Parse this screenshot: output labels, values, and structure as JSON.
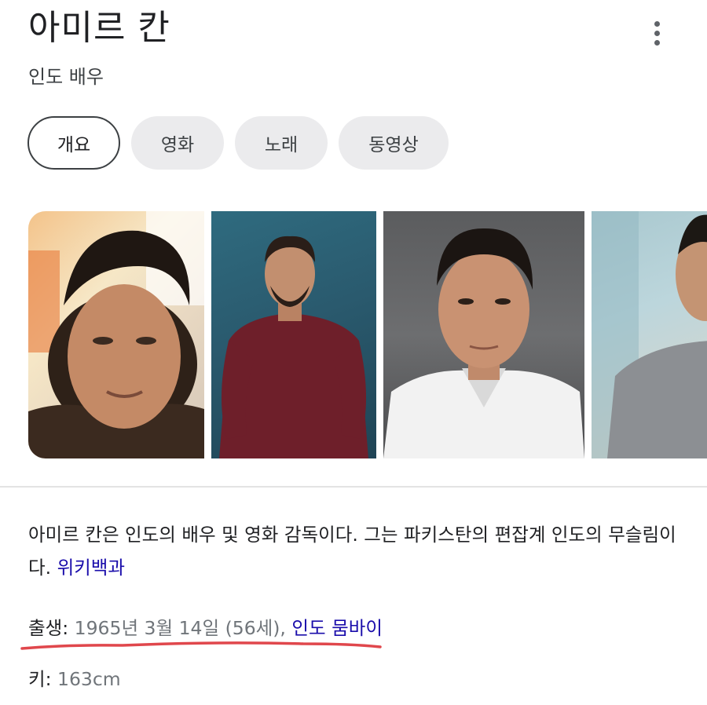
{
  "header": {
    "title": "아미르 칸",
    "subtitle": "인도 배우",
    "more_icon": "more-vertical-icon"
  },
  "tabs": [
    {
      "label": "개요",
      "active": true
    },
    {
      "label": "영화",
      "active": false
    },
    {
      "label": "노래",
      "active": false
    },
    {
      "label": "동영상",
      "active": false
    }
  ],
  "description": {
    "text": "아미르 칸은 인도의 배우 및 영화 감독이다. 그는 파키스탄의 편잡계 인도의 무슬림이다. ",
    "source_link": "위키백과"
  },
  "facts": {
    "birth": {
      "label": "출생",
      "value": "1965년 3월 14일 (56세), ",
      "place_link": "인도 뭄바이"
    },
    "height": {
      "label": "키",
      "value": "163cm"
    }
  },
  "colors": {
    "link": "#1a0dab",
    "annotation_underline": "#e0474c",
    "tab_bg": "#ebebed"
  }
}
